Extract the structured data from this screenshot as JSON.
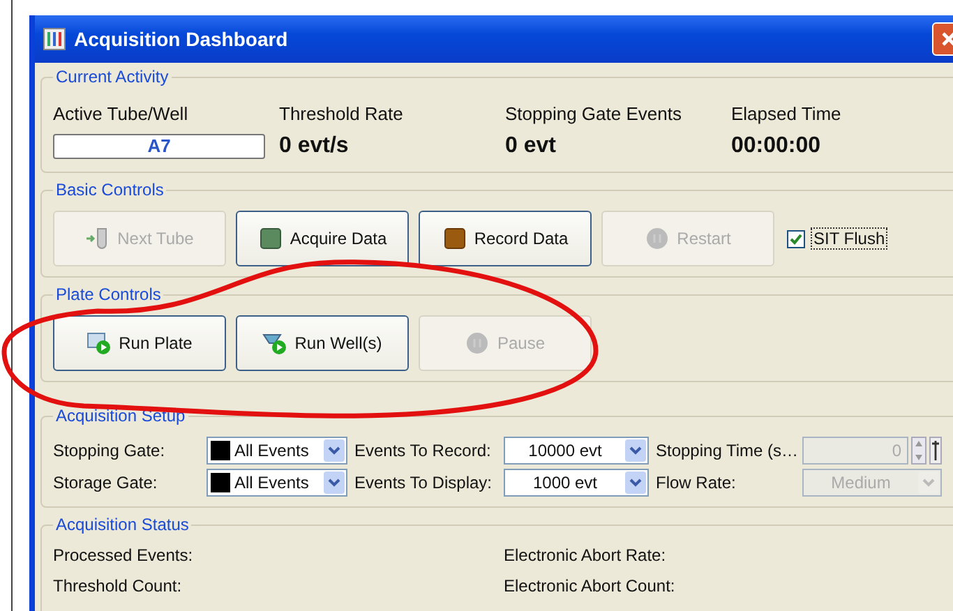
{
  "window": {
    "title": "Acquisition Dashboard"
  },
  "current_activity": {
    "title": "Current Activity",
    "items": [
      {
        "label": "Active Tube/Well",
        "value": "A7",
        "kind": "field"
      },
      {
        "label": "Threshold Rate",
        "value": "0 evt/s",
        "kind": "text"
      },
      {
        "label": "Stopping Gate Events",
        "value": "0 evt",
        "kind": "text"
      },
      {
        "label": "Elapsed Time",
        "value": "00:00:00",
        "kind": "text"
      }
    ]
  },
  "basic_controls": {
    "title": "Basic Controls",
    "buttons": [
      {
        "label": "Next Tube",
        "disabled": true
      },
      {
        "label": "Acquire Data",
        "disabled": false
      },
      {
        "label": "Record Data",
        "disabled": false
      },
      {
        "label": "Restart",
        "disabled": true
      }
    ],
    "checkbox": {
      "label": "SIT Flush",
      "checked": true
    }
  },
  "plate_controls": {
    "title": "Plate Controls",
    "buttons": [
      {
        "label": "Run Plate",
        "disabled": false
      },
      {
        "label": "Run Well(s)",
        "disabled": false
      },
      {
        "label": "Pause",
        "disabled": true
      }
    ]
  },
  "acquisition_setup": {
    "title": "Acquisition Setup",
    "rows": [
      [
        {
          "label": "Stopping Gate:",
          "kind": "gate-select",
          "value": "All Events",
          "disabled": false
        },
        {
          "label": "Events To Record:",
          "kind": "select",
          "value": "10000 evt",
          "disabled": false
        },
        {
          "label": "Stopping Time (s…",
          "kind": "spin-field",
          "value": "0",
          "disabled": true
        }
      ],
      [
        {
          "label": "Storage Gate:",
          "kind": "gate-select",
          "value": "All Events",
          "disabled": false
        },
        {
          "label": "Events To Display:",
          "kind": "select",
          "value": "1000 evt",
          "disabled": false
        },
        {
          "label": "Flow Rate:",
          "kind": "select",
          "value": "Medium",
          "disabled": true
        }
      ]
    ]
  },
  "acquisition_status": {
    "title": "Acquisition Status",
    "items": [
      "Processed Events:",
      "Electronic Abort Rate:",
      "Threshold Count:",
      "Electronic Abort Count:"
    ]
  }
}
